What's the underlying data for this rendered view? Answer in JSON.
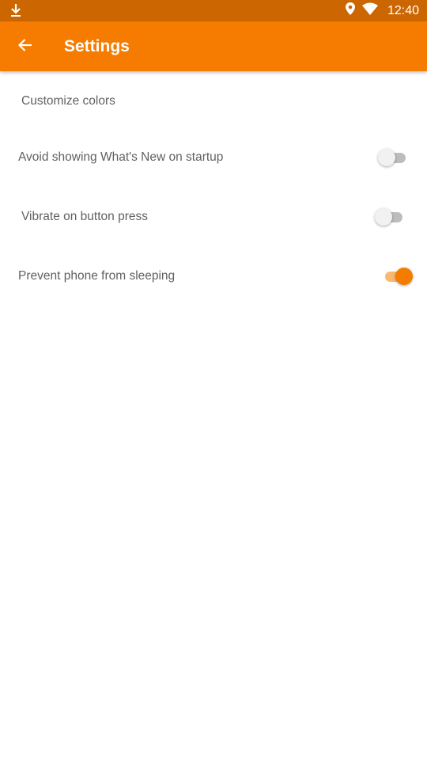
{
  "status_bar": {
    "time": "12:40",
    "left_icon": "download-icon",
    "right_icons": [
      "location-icon",
      "wifi-icon"
    ]
  },
  "app_bar": {
    "title": "Settings",
    "back_icon": "arrow-back-icon"
  },
  "settings": {
    "items": [
      {
        "label": "Customize colors",
        "has_switch": false
      },
      {
        "label": "Avoid showing What's New on startup",
        "has_switch": true,
        "checked": false
      },
      {
        "label": "Vibrate on button press",
        "has_switch": true,
        "checked": false
      },
      {
        "label": "Prevent phone from sleeping",
        "has_switch": true,
        "checked": true
      }
    ]
  },
  "colors": {
    "status_bar": "#cc6600",
    "app_bar": "#f57c00",
    "accent": "#f57c00",
    "label_text": "#616161"
  }
}
